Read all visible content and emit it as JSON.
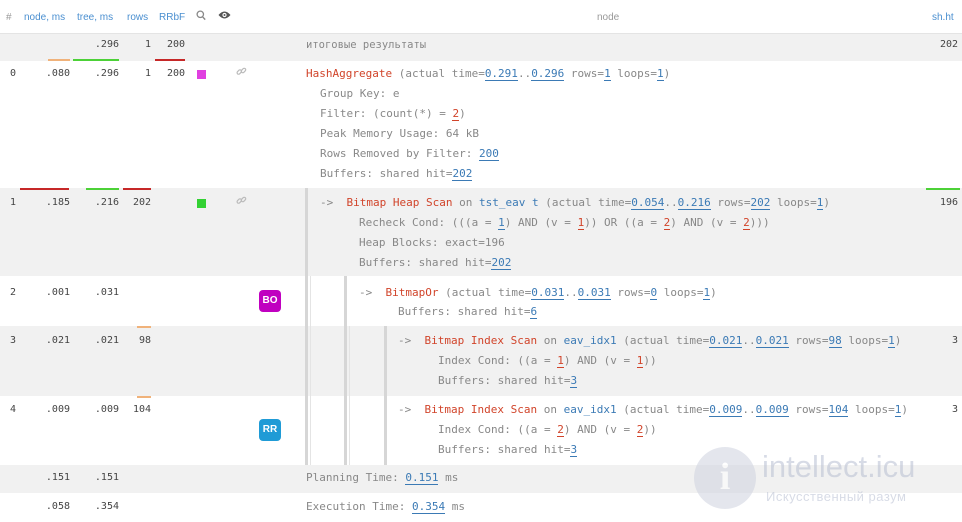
{
  "header": {
    "hash": "#",
    "node_ms": "node, ms",
    "tree_ms": "tree, ms",
    "rows": "rows",
    "rrbf": "RRbF",
    "node": "node",
    "shht": "sh.ht",
    "search_icon": "search-icon",
    "eye_icon": "eye-icon"
  },
  "summary": {
    "tree": ".296",
    "rows": "1",
    "rrbf": "200",
    "label": "итоговые результаты",
    "shht": "202"
  },
  "colors": {
    "accent": "#4a8fd0",
    "node_name": "#d1442a",
    "red_bar": "#c62828",
    "green_bar": "#4cd137",
    "orange_bar": "#f0b27a",
    "badge_bo": "#c000c0",
    "badge_rr": "#1f9bd6",
    "swatch_magenta": "#e040e0",
    "swatch_green": "#33d133"
  },
  "rows": [
    {
      "id": "0",
      "node": ".080",
      "tree": ".296",
      "rows": "1",
      "rrbf": "200",
      "swatch": "#e040e0",
      "link_icon": "link-icon",
      "op": "HashAggregate",
      "t1": "0.291",
      "t2": "0.296",
      "r": "1",
      "loops": "1",
      "group_key": "Group Key: e",
      "filter_a": "Filter: (count(*) = ",
      "filter_v": "2",
      "filter_b": ")",
      "peak": "Peak Memory Usage: 64 kB",
      "removed_label": "Rows Removed by Filter: ",
      "removed": "200",
      "buffers_label": "Buffers: shared hit=",
      "buffers": "202"
    },
    {
      "id": "1",
      "node": ".185",
      "tree": ".216",
      "rows": "202",
      "swatch": "#33d133",
      "link_icon": "link-icon",
      "op": "Bitmap Heap Scan",
      "on": "on",
      "obj": "tst_eav",
      "alias": "t",
      "t1": "0.054",
      "t2": "0.216",
      "r": "202",
      "loops": "1",
      "recheck_a": "Recheck Cond: (((a = ",
      "recheck_v1": "1",
      "recheck_b": ") AND (v = ",
      "recheck_v2": "1",
      "recheck_c": ")) OR ((a = ",
      "recheck_v3": "2",
      "recheck_d": ") AND (v = ",
      "recheck_v4": "2",
      "recheck_e": ")))",
      "heap_blocks": "Heap Blocks: exact=196",
      "buffers_label": "Buffers: shared hit=",
      "buffers": "202",
      "shht": "196"
    },
    {
      "id": "2",
      "node": ".001",
      "tree": ".031",
      "badge": "BO",
      "op": "BitmapOr",
      "t1": "0.031",
      "t2": "0.031",
      "r": "0",
      "loops": "1",
      "buffers_label": "Buffers: shared hit=",
      "buffers": "6"
    },
    {
      "id": "3",
      "node": ".021",
      "tree": ".021",
      "rows": "98",
      "op": "Bitmap Index Scan",
      "on": "on",
      "obj": "eav_idx1",
      "t1": "0.021",
      "t2": "0.021",
      "r": "98",
      "loops": "1",
      "cond_a": "Index Cond: ((a = ",
      "cond_v1": "1",
      "cond_b": ") AND (v = ",
      "cond_v2": "1",
      "cond_c": "))",
      "buffers_label": "Buffers: shared hit=",
      "buffers": "3",
      "shht": "3"
    },
    {
      "id": "4",
      "node": ".009",
      "tree": ".009",
      "rows": "104",
      "badge": "RR",
      "op": "Bitmap Index Scan",
      "on": "on",
      "obj": "eav_idx1",
      "t1": "0.009",
      "t2": "0.009",
      "r": "104",
      "loops": "1",
      "cond_a": "Index Cond: ((a = ",
      "cond_v1": "2",
      "cond_b": ") AND (v = ",
      "cond_v2": "2",
      "cond_c": "))",
      "buffers_label": "Buffers: shared hit=",
      "buffers": "3",
      "shht": "3"
    }
  ],
  "planning": {
    "node": ".151",
    "tree": ".151",
    "label": "Planning Time: ",
    "value": "0.151",
    "unit": " ms"
  },
  "execution": {
    "node": ".058",
    "tree": ".354",
    "label": "Execution Time: ",
    "value": "0.354",
    "unit": " ms"
  },
  "common": {
    "actual_time": "(actual time=",
    "dots": "..",
    "rows_eq": " rows=",
    "loops_eq": " loops=",
    "close": ")",
    "arrow": "->"
  },
  "watermark": {
    "logo": "i",
    "title": "intellect.icu",
    "subtitle": "Искусственный разум"
  }
}
